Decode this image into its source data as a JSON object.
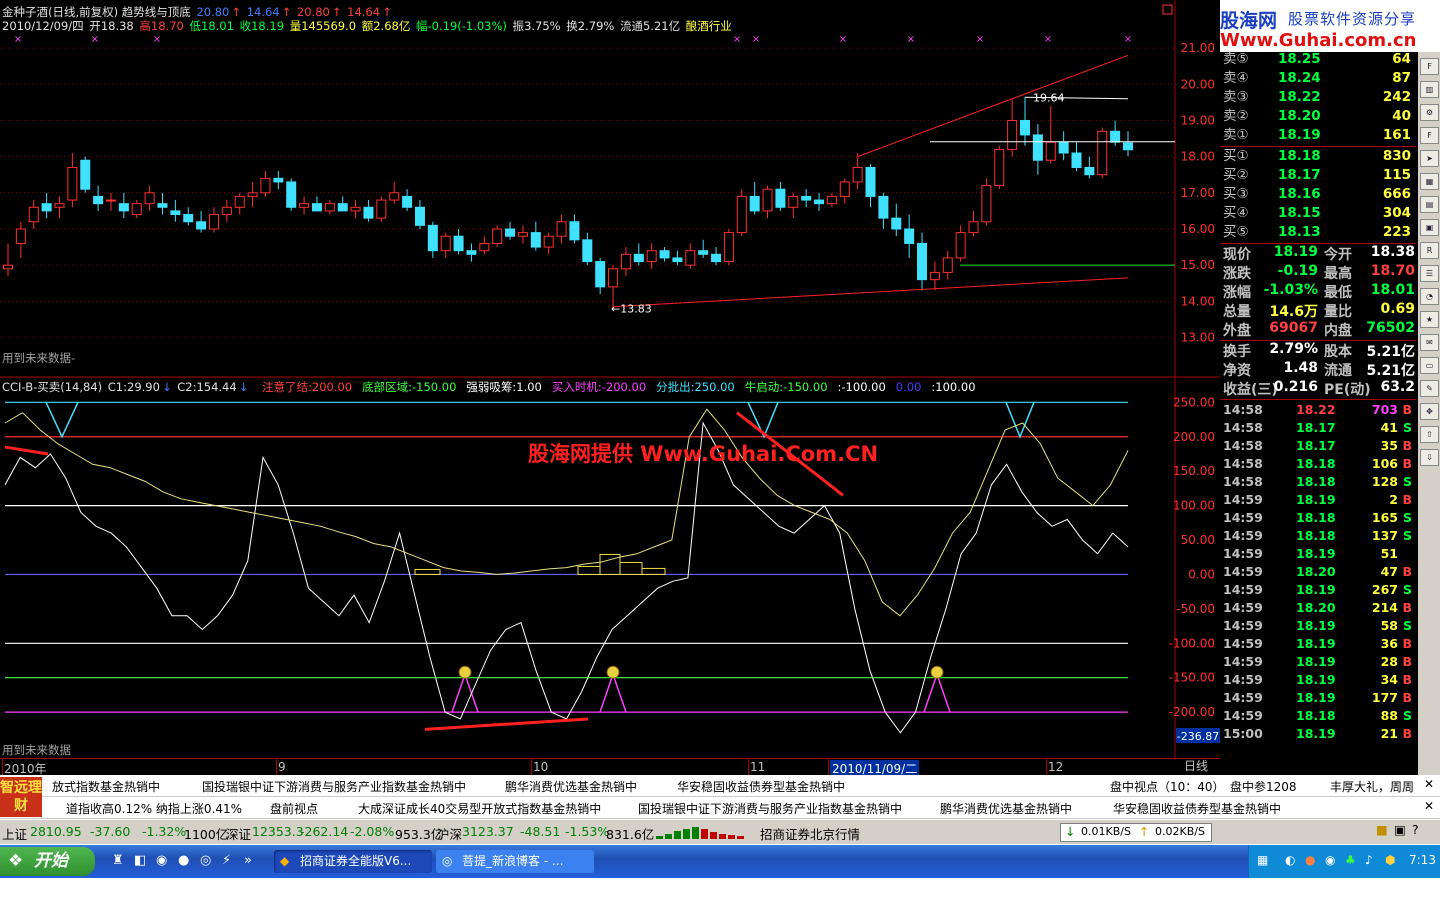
{
  "header": {
    "title": "金种子酒(日线,前复权) 趋势线与顶底",
    "title_vals": [
      "20.80",
      "14.64",
      "20.80",
      "14.64"
    ],
    "info": {
      "date": "2010/12/09/四",
      "open": "开18.38",
      "high": "高18.70",
      "low": "低18.01",
      "close": "收18.19",
      "vol": "量145569.0",
      "amount": "额2.68亿",
      "change": "幅-0.19(-1.03%)",
      "amp": "振3.75%",
      "turnover": "换2.79%",
      "float": "流通5.21亿",
      "industry": "酿酒行业"
    },
    "future_note_main": "用到未来数据-",
    "future_note_ind": "用到未来数据"
  },
  "indicator": {
    "name": "CCI-B-买卖(14,84)",
    "c1": "C1:29.90",
    "c2": "C2:154.44",
    "items": [
      {
        "label": "注意了结:200.00",
        "color": "#ff4040"
      },
      {
        "label": "底部区域:-150.00",
        "color": "#40ff40"
      },
      {
        "label": "强弱吸筹:1.00",
        "color": "#ffffff"
      },
      {
        "label": "买入时机:-200.00",
        "color": "#ff40ff"
      },
      {
        "label": "分批出:250.00",
        "color": "#40e0ff"
      },
      {
        "label": "牛启动:-150.00",
        "color": "#40ff40"
      },
      {
        "label": ":-100.00",
        "color": "#ffffff"
      },
      {
        "label": "0.00",
        "color": "#4040ff"
      },
      {
        "label": ":100.00",
        "color": "#ffffff"
      }
    ],
    "watermark": "股海网提供 Www.Guhai.Com.CN",
    "low_readout": "-236.87"
  },
  "chart_data": [
    {
      "type": "candlestick",
      "y_axis_ticks": [
        "21.00",
        "20.00",
        "19.00",
        "18.00",
        "17.00",
        "16.00",
        "15.00",
        "14.00",
        "13.00"
      ],
      "ylim": [
        12.6,
        21.5
      ],
      "annotations": [
        {
          "text": "19.64",
          "value": 19.64
        },
        {
          "text": "←13.83",
          "value": 13.83
        }
      ],
      "x_labels": [
        "2010年",
        "9",
        "10",
        "11",
        "2010/11/09/二",
        "12"
      ],
      "candles": [
        [
          14.9,
          15.6,
          14.7,
          15.0
        ],
        [
          15.6,
          16.2,
          15.2,
          16.0
        ],
        [
          16.2,
          16.8,
          16.0,
          16.6
        ],
        [
          16.7,
          17.0,
          16.3,
          16.5
        ],
        [
          16.6,
          16.9,
          16.3,
          16.7
        ],
        [
          16.8,
          18.1,
          16.6,
          17.7
        ],
        [
          17.9,
          18.0,
          17.0,
          17.1
        ],
        [
          16.9,
          17.2,
          16.5,
          16.7
        ],
        [
          16.8,
          17.0,
          16.5,
          16.8
        ],
        [
          16.7,
          17.0,
          16.3,
          16.5
        ],
        [
          16.4,
          16.8,
          16.3,
          16.7
        ],
        [
          16.7,
          17.2,
          16.5,
          17.0
        ],
        [
          16.7,
          17.0,
          16.4,
          16.6
        ],
        [
          16.5,
          16.8,
          16.2,
          16.4
        ],
        [
          16.4,
          16.6,
          16.1,
          16.2
        ],
        [
          16.2,
          16.5,
          15.9,
          16.0
        ],
        [
          16.0,
          16.6,
          15.9,
          16.4
        ],
        [
          16.4,
          16.8,
          16.2,
          16.6
        ],
        [
          16.6,
          17.0,
          16.4,
          16.9
        ],
        [
          16.9,
          17.3,
          16.6,
          17.0
        ],
        [
          17.0,
          17.6,
          16.9,
          17.4
        ],
        [
          17.4,
          17.6,
          17.1,
          17.3
        ],
        [
          17.3,
          17.4,
          16.5,
          16.6
        ],
        [
          16.6,
          16.9,
          16.4,
          16.7
        ],
        [
          16.7,
          16.9,
          16.5,
          16.5
        ],
        [
          16.5,
          16.8,
          16.4,
          16.7
        ],
        [
          16.7,
          16.9,
          16.5,
          16.5
        ],
        [
          16.5,
          16.8,
          16.3,
          16.6
        ],
        [
          16.6,
          16.8,
          16.2,
          16.3
        ],
        [
          16.3,
          16.9,
          16.2,
          16.8
        ],
        [
          16.8,
          17.3,
          16.7,
          17.0
        ],
        [
          16.9,
          17.1,
          16.5,
          16.6
        ],
        [
          16.6,
          16.8,
          16.0,
          16.1
        ],
        [
          16.1,
          16.2,
          15.2,
          15.4
        ],
        [
          15.4,
          15.9,
          15.2,
          15.8
        ],
        [
          15.8,
          16.0,
          15.3,
          15.4
        ],
        [
          15.4,
          15.6,
          15.1,
          15.3
        ],
        [
          15.4,
          15.8,
          15.3,
          15.6
        ],
        [
          15.6,
          16.1,
          15.5,
          16.0
        ],
        [
          16.0,
          16.2,
          15.7,
          15.8
        ],
        [
          15.8,
          16.1,
          15.6,
          15.9
        ],
        [
          15.9,
          16.2,
          15.4,
          15.5
        ],
        [
          15.5,
          15.9,
          15.3,
          15.8
        ],
        [
          15.8,
          16.4,
          15.6,
          16.2
        ],
        [
          16.2,
          16.4,
          15.6,
          15.7
        ],
        [
          15.7,
          15.9,
          15.0,
          15.1
        ],
        [
          15.1,
          15.2,
          14.2,
          14.4
        ],
        [
          14.4,
          15.0,
          13.8,
          14.9
        ],
        [
          14.9,
          15.5,
          14.7,
          15.3
        ],
        [
          15.3,
          15.6,
          15.0,
          15.1
        ],
        [
          15.1,
          15.6,
          14.9,
          15.4
        ],
        [
          15.4,
          15.5,
          15.1,
          15.2
        ],
        [
          15.2,
          15.4,
          15.0,
          15.1
        ],
        [
          15.0,
          15.6,
          14.9,
          15.4
        ],
        [
          15.4,
          15.7,
          15.2,
          15.3
        ],
        [
          15.3,
          15.5,
          15.0,
          15.1
        ],
        [
          15.1,
          16.0,
          15.0,
          15.9
        ],
        [
          15.9,
          17.1,
          15.8,
          16.9
        ],
        [
          16.9,
          17.3,
          16.4,
          16.5
        ],
        [
          16.5,
          17.2,
          16.3,
          17.1
        ],
        [
          17.1,
          17.3,
          16.5,
          16.6
        ],
        [
          16.6,
          17.0,
          16.3,
          16.9
        ],
        [
          16.9,
          17.1,
          16.6,
          16.8
        ],
        [
          16.8,
          17.0,
          16.5,
          16.7
        ],
        [
          16.7,
          17.0,
          16.6,
          16.9
        ],
        [
          16.9,
          17.4,
          16.7,
          17.3
        ],
        [
          17.3,
          18.1,
          17.1,
          17.7
        ],
        [
          17.7,
          17.8,
          16.6,
          16.9
        ],
        [
          16.9,
          17.0,
          16.0,
          16.3
        ],
        [
          16.3,
          16.7,
          15.8,
          16.0
        ],
        [
          16.0,
          16.4,
          15.2,
          15.6
        ],
        [
          15.6,
          15.9,
          14.3,
          14.6
        ],
        [
          14.6,
          15.1,
          14.3,
          14.8
        ],
        [
          14.8,
          15.4,
          14.6,
          15.2
        ],
        [
          15.2,
          16.1,
          15.1,
          15.9
        ],
        [
          15.9,
          16.5,
          15.8,
          16.2
        ],
        [
          16.2,
          17.4,
          16.1,
          17.2
        ],
        [
          17.2,
          18.3,
          17.1,
          18.2
        ],
        [
          18.2,
          19.6,
          18.0,
          19.0
        ],
        [
          19.0,
          19.64,
          18.3,
          18.6
        ],
        [
          18.6,
          18.9,
          17.5,
          17.9
        ],
        [
          17.9,
          19.4,
          17.8,
          18.4
        ],
        [
          18.4,
          18.7,
          17.9,
          18.1
        ],
        [
          18.1,
          18.4,
          17.6,
          17.7
        ],
        [
          17.7,
          18.0,
          17.4,
          17.5
        ],
        [
          17.5,
          18.8,
          17.4,
          18.7
        ],
        [
          18.7,
          19.0,
          18.3,
          18.4
        ],
        [
          18.38,
          18.7,
          18.01,
          18.19
        ]
      ]
    },
    {
      "type": "line",
      "y_axis_ticks": [
        "250.00",
        "200.00",
        "150.00",
        "100.00",
        "50.00",
        "0.00",
        "-50.00",
        "-100.00",
        "-150.00",
        "-200.00"
      ],
      "ylim": [
        -255,
        265
      ],
      "series": [
        {
          "values": [
            130,
            170,
            155,
            175,
            140,
            90,
            70,
            60,
            40,
            10,
            -20,
            -60,
            -60,
            -80,
            -60,
            -30,
            20,
            170,
            130,
            60,
            -20,
            -40,
            -60,
            -30,
            -70,
            -10,
            60,
            -30,
            -120,
            -200,
            -210,
            -160,
            -110,
            -80,
            -70,
            -140,
            -200,
            -210,
            -170,
            -120,
            -80,
            -60,
            -40,
            -20,
            -10,
            -5,
            220,
            180,
            130,
            110,
            90,
            70,
            60,
            80,
            100,
            60,
            -50,
            -140,
            -200,
            -230,
            -200,
            -120,
            -50,
            30,
            60,
            130,
            160,
            120,
            90,
            70,
            80,
            50,
            30,
            60,
            40
          ]
        },
        {
          "values": [
            220,
            235,
            210,
            190,
            175,
            160,
            155,
            145,
            135,
            120,
            110,
            105,
            100,
            95,
            90,
            85,
            80,
            75,
            70,
            62,
            55,
            45,
            40,
            30,
            20,
            10,
            5,
            3,
            0,
            2,
            5,
            8,
            10,
            15,
            18,
            25,
            30,
            40,
            50,
            200,
            240,
            210,
            170,
            140,
            115,
            100,
            90,
            80,
            60,
            20,
            -40,
            -60,
            -30,
            10,
            60,
            90,
            150,
            210,
            220,
            190,
            140,
            120,
            100,
            130,
            180
          ]
        }
      ]
    }
  ],
  "panel": {
    "logo_cn": "股海网",
    "logo_sub": "股票软件资源分享",
    "logo_url": "Www.Guhai.com.cn",
    "sells": [
      {
        "label": "卖⑤",
        "price": "18.25",
        "vol": "64"
      },
      {
        "label": "卖④",
        "price": "18.24",
        "vol": "87"
      },
      {
        "label": "卖③",
        "price": "18.22",
        "vol": "242"
      },
      {
        "label": "卖②",
        "price": "18.20",
        "vol": "40"
      },
      {
        "label": "卖①",
        "price": "18.19",
        "vol": "161"
      }
    ],
    "buys": [
      {
        "label": "买①",
        "price": "18.18",
        "vol": "830"
      },
      {
        "label": "买②",
        "price": "18.17",
        "vol": "115"
      },
      {
        "label": "买③",
        "price": "18.16",
        "vol": "666"
      },
      {
        "label": "买④",
        "price": "18.15",
        "vol": "304"
      },
      {
        "label": "买⑤",
        "price": "18.13",
        "vol": "223"
      }
    ],
    "stats": [
      {
        "l1": "现价",
        "v1": "18.19",
        "c1": "#00ff40",
        "l2": "今开",
        "v2": "18.38",
        "c2": "#ffffff"
      },
      {
        "l1": "涨跌",
        "v1": "-0.19",
        "c1": "#00ff40",
        "l2": "最高",
        "v2": "18.70",
        "c2": "#ff4040"
      },
      {
        "l1": "涨幅",
        "v1": "-1.03%",
        "c1": "#00ff40",
        "l2": "最低",
        "v2": "18.01",
        "c2": "#00ff40"
      },
      {
        "l1": "总量",
        "v1": "14.6万",
        "c1": "#ffff40",
        "l2": "量比",
        "v2": "0.69",
        "c2": "#ffff40"
      },
      {
        "l1": "外盘",
        "v1": "69067",
        "c1": "#ff4040",
        "l2": "内盘",
        "v2": "76502",
        "c2": "#00ff40"
      }
    ],
    "stats2": [
      {
        "l1": "换手",
        "v1": "2.79%",
        "l2": "股本",
        "v2": "5.21亿"
      },
      {
        "l1": "净资",
        "v1": "1.48",
        "l2": "流通",
        "v2": "5.21亿"
      },
      {
        "l1": "收益(三)",
        "v1": "0.216",
        "l2": "PE(动)",
        "v2": "63.2"
      }
    ],
    "ticks": [
      {
        "t": "14:58",
        "p": "18.22",
        "pc": "#ff4040",
        "v": "703",
        "vc": "#ff40ff",
        "bs": "B",
        "bc": "#ff4040"
      },
      {
        "t": "14:58",
        "p": "18.17",
        "pc": "#00ff40",
        "v": "41",
        "vc": "#ffff40",
        "bs": "S",
        "bc": "#00ff40"
      },
      {
        "t": "14:58",
        "p": "18.17",
        "pc": "#00ff40",
        "v": "35",
        "vc": "#ffff40",
        "bs": "B",
        "bc": "#ff4040"
      },
      {
        "t": "14:58",
        "p": "18.18",
        "pc": "#00ff40",
        "v": "106",
        "vc": "#ffff40",
        "bs": "B",
        "bc": "#ff4040"
      },
      {
        "t": "14:58",
        "p": "18.18",
        "pc": "#00ff40",
        "v": "128",
        "vc": "#ffff40",
        "bs": "S",
        "bc": "#00ff40"
      },
      {
        "t": "14:59",
        "p": "18.19",
        "pc": "#00ff40",
        "v": "2",
        "vc": "#ffff40",
        "bs": "B",
        "bc": "#ff4040"
      },
      {
        "t": "14:59",
        "p": "18.18",
        "pc": "#00ff40",
        "v": "165",
        "vc": "#ffff40",
        "bs": "S",
        "bc": "#00ff40"
      },
      {
        "t": "14:59",
        "p": "18.18",
        "pc": "#00ff40",
        "v": "137",
        "vc": "#ffff40",
        "bs": "S",
        "bc": "#00ff40"
      },
      {
        "t": "14:59",
        "p": "18.19",
        "pc": "#00ff40",
        "v": "51",
        "vc": "#ffff40",
        "bs": "",
        "bc": "#ff4040"
      },
      {
        "t": "14:59",
        "p": "18.20",
        "pc": "#00ff40",
        "v": "47",
        "vc": "#ffff40",
        "bs": "B",
        "bc": "#ff4040"
      },
      {
        "t": "14:59",
        "p": "18.19",
        "pc": "#00ff40",
        "v": "267",
        "vc": "#ffff40",
        "bs": "S",
        "bc": "#00ff40"
      },
      {
        "t": "14:59",
        "p": "18.20",
        "pc": "#00ff40",
        "v": "214",
        "vc": "#ffff40",
        "bs": "B",
        "bc": "#ff4040"
      },
      {
        "t": "14:59",
        "p": "18.19",
        "pc": "#00ff40",
        "v": "58",
        "vc": "#ffff40",
        "bs": "S",
        "bc": "#00ff40"
      },
      {
        "t": "14:59",
        "p": "18.19",
        "pc": "#00ff40",
        "v": "36",
        "vc": "#ffff40",
        "bs": "B",
        "bc": "#ff4040"
      },
      {
        "t": "14:59",
        "p": "18.19",
        "pc": "#00ff40",
        "v": "28",
        "vc": "#ffff40",
        "bs": "B",
        "bc": "#ff4040"
      },
      {
        "t": "14:59",
        "p": "18.19",
        "pc": "#00ff40",
        "v": "34",
        "vc": "#ffff40",
        "bs": "B",
        "bc": "#ff4040"
      },
      {
        "t": "14:59",
        "p": "18.19",
        "pc": "#00ff40",
        "v": "177",
        "vc": "#ffff40",
        "bs": "B",
        "bc": "#ff4040"
      },
      {
        "t": "14:59",
        "p": "18.18",
        "pc": "#00ff40",
        "v": "88",
        "vc": "#ffff40",
        "bs": "S",
        "bc": "#00ff40"
      },
      {
        "t": "15:00",
        "p": "18.19",
        "pc": "#00ff40",
        "v": "21",
        "vc": "#ffff40",
        "bs": "B",
        "bc": "#ff4040"
      }
    ],
    "tabs": [
      "笔",
      "价",
      "细",
      "盘",
      "势",
      "指",
      "值",
      "筹"
    ],
    "period_label": "日线"
  },
  "tickers": {
    "row1": [
      "放式指数基金热销中",
      "国投瑞银中证下游消费与服务产业指数基金热销中",
      "鹏华消费优选基金热销中",
      "华安稳固收益债券型基金热销中",
      "盘中视点（10：40）",
      "盘中参1208",
      "丰厚大礼，周周"
    ],
    "row2": [
      "道指收高0.12% 纳指上涨0.41%",
      "盘前视点",
      "大成深证成长40交易型开放式指数基金热销中",
      "国投瑞银中证下游消费与服务产业指数基金热销中",
      "鹏华消费优选基金热销中",
      "华安稳固收益债券型基金热销中"
    ],
    "logo_text": "智远理财"
  },
  "status": {
    "sh": {
      "name": "上证",
      "val": "2810.95",
      "chg": "-37.60",
      "pct": "-1.32%",
      "amt": "1100亿"
    },
    "sz": {
      "name": "深证",
      "val": "12353.3",
      "chg": "-262.14",
      "pct": "-2.08%",
      "amt": "953.3亿"
    },
    "hs": {
      "name": "沪深",
      "val": "3123.37",
      "chg": "-48.51",
      "pct": "-1.53%",
      "amt": "831.6亿"
    },
    "broker": "招商证券北京行情",
    "down_speed": "0.01KB/S",
    "up_speed": "0.02KB/S"
  },
  "taskbar": {
    "start": "开始",
    "apps": [
      "招商证券全能版V6...",
      "菩提_新浪博客 - ..."
    ],
    "clock": "7:13"
  }
}
